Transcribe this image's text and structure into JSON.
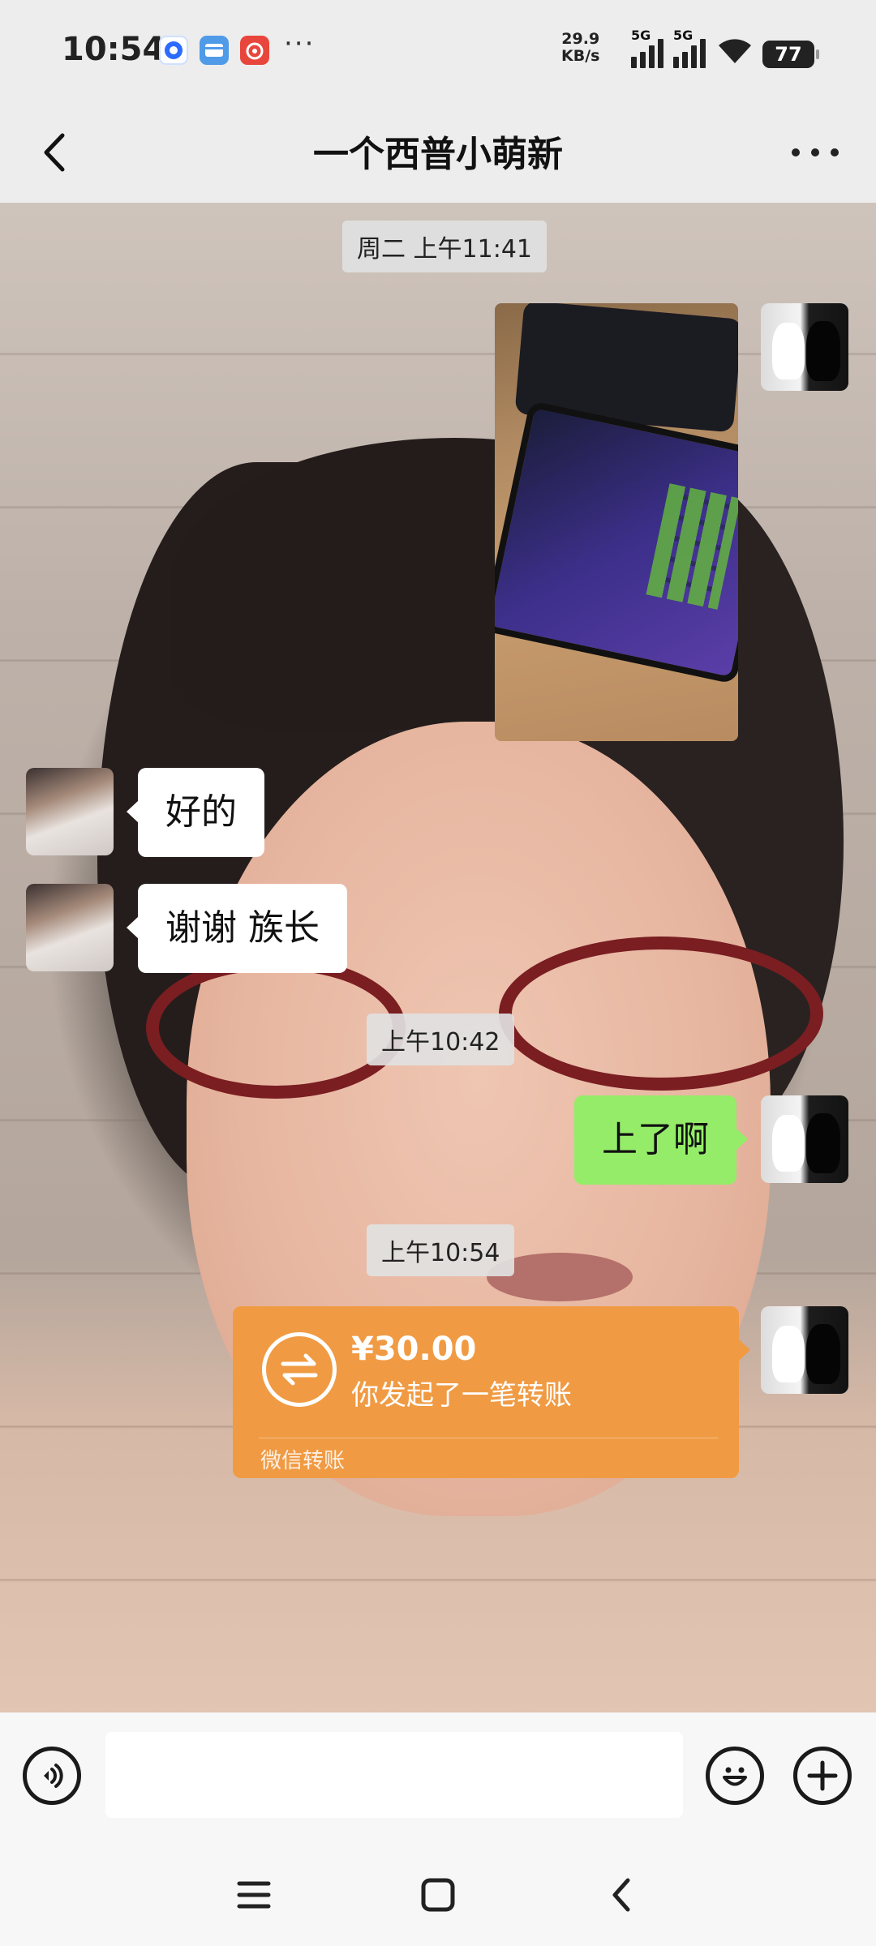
{
  "status_bar": {
    "time": "10:54",
    "speed_value": "29.9",
    "speed_unit": "KB/s",
    "network_1": "5G",
    "network_2": "5G",
    "battery": "77",
    "overflow": "···",
    "app_icons": [
      "blue-circle-app-icon",
      "card-app-icon",
      "red-music-app-icon"
    ]
  },
  "header": {
    "title": "一个西普小萌新"
  },
  "messages": {
    "timestamp_1": "周二 上午11:41",
    "reply_1": "好的",
    "reply_2": "谢谢 族长",
    "timestamp_2": "上午10:42",
    "sent_1": "上了啊",
    "timestamp_3": "上午10:54",
    "transfer": {
      "amount": "¥30.00",
      "description": "你发起了一笔转账",
      "footer": "微信转账"
    }
  },
  "input_bar": {
    "value": "",
    "placeholder": ""
  },
  "colors": {
    "sent_bubble": "#95ec69",
    "transfer_card": "#f09b44",
    "bar_background": "#ededed"
  }
}
